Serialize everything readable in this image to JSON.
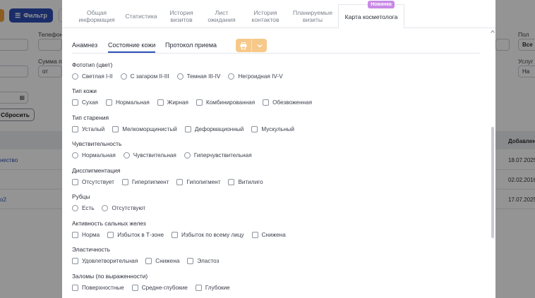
{
  "background": {
    "filter_label": "Фильтр",
    "phone_label": "Телефон",
    "sum_label": "Сумма п",
    "from_placeholder": "от",
    "sex_label": "Пол",
    "sex_value": "Все",
    "services_label": "Услуг",
    "services_value": "На",
    "reset_label": "Сбросить",
    "added_header": "Добавлен",
    "rows": [
      {
        "link": "нество",
        "date": "18.07.2025"
      },
      {
        "link": "",
        "date": "02.02.2016"
      },
      {
        "link": "o2",
        "date": "17.07.2025"
      }
    ]
  },
  "tabs": [
    {
      "label": "Общая информация",
      "active": false
    },
    {
      "label": "Статистика",
      "active": false
    },
    {
      "label": "История визитов",
      "active": false
    },
    {
      "label": "Лист ожидания",
      "active": false
    },
    {
      "label": "История контактов",
      "active": false
    },
    {
      "label": "Планируемые визиты",
      "active": false
    },
    {
      "label": "Карта косметолога",
      "active": true
    }
  ],
  "new_badge": "Новинка",
  "subtabs": [
    {
      "label": "Анамнез",
      "active": false
    },
    {
      "label": "Состояние кожи",
      "active": true
    },
    {
      "label": "Протокол приема",
      "active": false
    }
  ],
  "sections": [
    {
      "title": "Фототип (цвет)",
      "kind": "radio",
      "options": [
        "Светлая I-II",
        "С загаром II-III",
        "Темная III-IV",
        "Негроидная IV-V"
      ]
    },
    {
      "title": "Тип кожи",
      "kind": "checkbox",
      "options": [
        "Сухая",
        "Нормальная",
        "Жирная",
        "Комбинированная",
        "Обезвоженная"
      ]
    },
    {
      "title": "Тип старения",
      "kind": "checkbox",
      "options": [
        "Усталый",
        "Мелкоморщинистый",
        "Деформационный",
        "Мускульный"
      ]
    },
    {
      "title": "Чувствительность",
      "kind": "radio",
      "options": [
        "Нормальная",
        "Чувствительная",
        "Гиперчувствительная"
      ]
    },
    {
      "title": "Дисспигментация",
      "kind": "checkbox",
      "options": [
        "Отсутствует",
        "Гиперпигмент",
        "Гипопигмент",
        "Витилиго"
      ]
    },
    {
      "title": "Рубцы",
      "kind": "radio",
      "options": [
        "Есть",
        "Отсутствуют"
      ]
    },
    {
      "title": "Активность сальных желез",
      "kind": "checkbox",
      "options": [
        "Норма",
        "Избыток в Т-зоне",
        "Избыток по всему лицу",
        "Снижена"
      ]
    },
    {
      "title": "Эластичность",
      "kind": "checkbox",
      "options": [
        "Удовлетворительная",
        "Снижена",
        "Эластоз"
      ]
    },
    {
      "title": "Заломы (по выраженности)",
      "kind": "checkbox",
      "options": [
        "Поверхностные",
        "Средне-глубокие",
        "Глубокие"
      ]
    }
  ],
  "colors": {
    "accent": "#2e4fb6",
    "print_button": "#f6c98a",
    "badge": "#c889e6"
  }
}
